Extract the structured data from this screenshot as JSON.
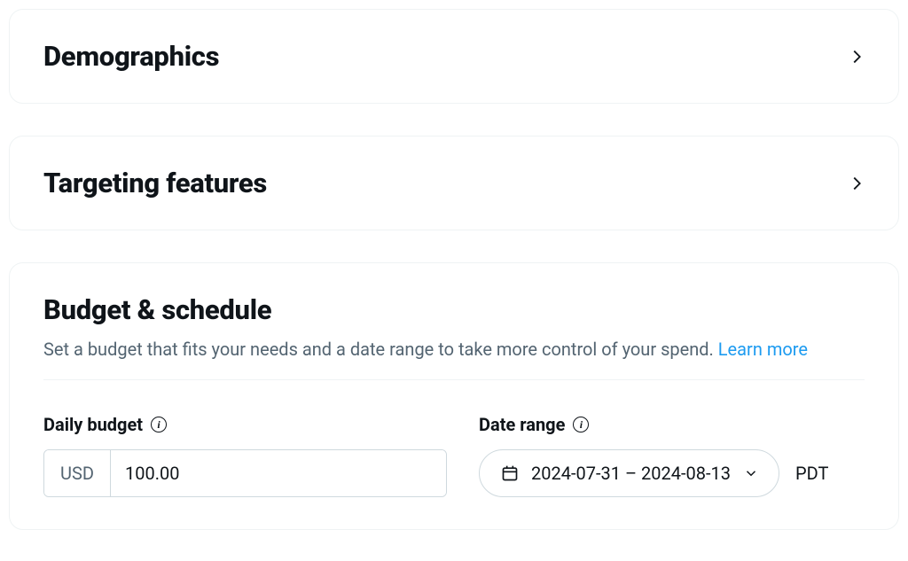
{
  "sections": {
    "demographics": {
      "title": "Demographics"
    },
    "targeting": {
      "title": "Targeting features"
    },
    "budget": {
      "title": "Budget & schedule",
      "subtitle": "Set a budget that fits your needs and a date range to take more control of your spend. ",
      "learn_more": "Learn more",
      "daily_budget": {
        "label": "Daily budget",
        "currency": "USD",
        "amount": "100.00"
      },
      "date_range": {
        "label": "Date range",
        "value": "2024-07-31 – 2024-08-13",
        "timezone": "PDT"
      }
    }
  }
}
